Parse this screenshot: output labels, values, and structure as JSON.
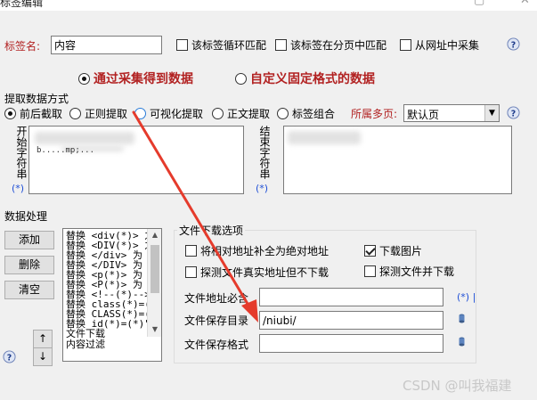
{
  "window": {
    "title": "标签编辑"
  },
  "tag_name": {
    "label": "标签名:",
    "value": "内容"
  },
  "top_options": [
    {
      "label": "该标签循环匹配",
      "checked": false
    },
    {
      "label": "该标签在分页中匹配",
      "checked": false
    },
    {
      "label": "从网址中采集",
      "checked": false
    }
  ],
  "source_mode": {
    "collect_label": "通过采集得到数据",
    "fixed_label": "自定义固定格式的数据"
  },
  "extract": {
    "section_label": "提取数据方式",
    "options": [
      "前后截取",
      "正则提取",
      "可视化提取",
      "正文提取",
      "标签组合"
    ],
    "page_label": "所属多页:",
    "page_value": "默认页",
    "start_label": "开始字符串",
    "start_value": "b.....mp;...",
    "start_star": "(*)",
    "end_label": "结束字符串",
    "end_star": "(*)"
  },
  "processing": {
    "section_label": "数据处理",
    "add_button": "添加",
    "delete_button": "删除",
    "clear_button": "清空",
    "up_arrow": "↑",
    "down_arrow": "↓",
    "list_items": [
      "替换 <div(*)> 之",
      "替换 <DIV(*)> 之",
      "替换 </div> 为",
      "替换 </DIV> 为",
      "替换 <p(*)> 为",
      "替换 <P(*)> 为",
      "替换 <!--(*)-->",
      "替换 class(*)=(",
      "替换 CLASS(*)=(",
      "替换 id(*)=(*)\"",
      "文件下载",
      "内容过滤"
    ]
  },
  "download": {
    "section_label": "文件下载选项",
    "relative_to_absolute": "将相对地址补全为绝对地址",
    "download_images": "下载图片",
    "detect_no_download": "探测文件真实地址但不下载",
    "detect_and_download": "探测文件并下载",
    "address_label": "文件地址必含",
    "address_value": "",
    "address_suffix": "(*) |",
    "save_dir_label": "文件保存目录",
    "save_dir_value": "/niubi/",
    "save_format_label": "文件保存格式",
    "save_format_value": ""
  },
  "watermark": "CSDN @叫我福建",
  "colors": {
    "accent_red": "#b22222",
    "link_blue": "#1f4fd6",
    "arrow_red": "#e53b2c"
  }
}
